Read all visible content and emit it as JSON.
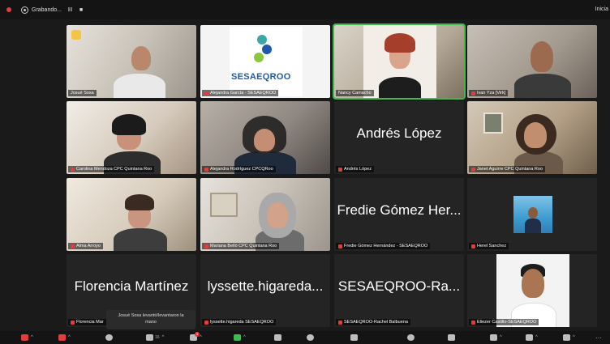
{
  "topbar": {
    "recording_label": "Grabando...",
    "right_label": "Inicia"
  },
  "tiles": [
    {
      "name": "Josué Sosa",
      "big": ""
    },
    {
      "name": "Alejandra García - SESAEQROO",
      "big": "",
      "logo": "SESAEQROO"
    },
    {
      "name": "Nancy Camacho",
      "big": ""
    },
    {
      "name": "Ivan Yza [Virk]",
      "big": ""
    },
    {
      "name": "Carolina Mendoza CPC Quintana Roo",
      "big": ""
    },
    {
      "name": "Alejandra Rodríguez CPCQRoo",
      "big": ""
    },
    {
      "name": "Andrés López",
      "big": "Andrés López"
    },
    {
      "name": "Janet Aguirre CPC Quintana Roo",
      "big": ""
    },
    {
      "name": "Alma Arroyo",
      "big": ""
    },
    {
      "name": "Mariana Belló CPC Quintana Roo",
      "big": ""
    },
    {
      "name": "Fredie Gómez Hernández - SESAEQROO",
      "big": "Fredie Gómez Her..."
    },
    {
      "name": "Herel Sanchez",
      "big": ""
    },
    {
      "name": "Florencia Mar",
      "big": "Florencia Martínez"
    },
    {
      "name": "lyssette.higareda SESAEQROO",
      "big": "lyssette.higareda..."
    },
    {
      "name": "SESAEQROO-Rachel Balbuena",
      "big": "SESAEQROO-Ra..."
    },
    {
      "name": "Eliezer Castillo-SESAEQROO",
      "big": ""
    }
  ],
  "tooltip": {
    "line1": "Josué Sosa levantó/levantaron la",
    "line2": "mano"
  },
  "toolbar": {
    "participants_count": "16",
    "chat_badge": "3"
  }
}
